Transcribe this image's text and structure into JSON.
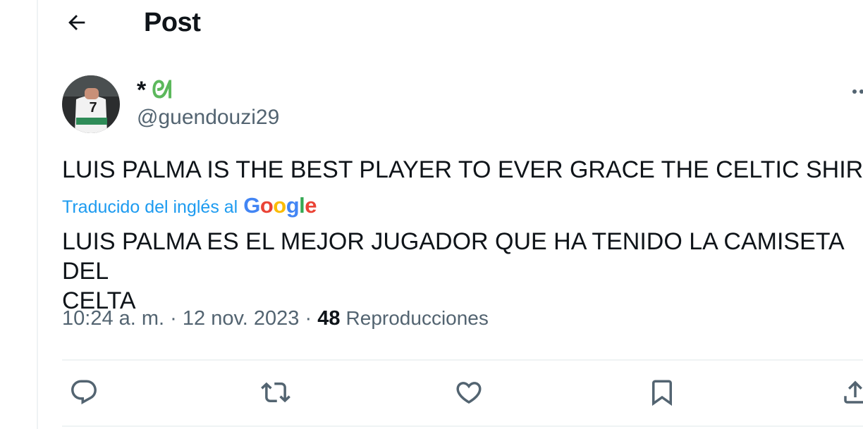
{
  "header": {
    "title": "Post",
    "back_icon": "arrow-left-icon"
  },
  "author": {
    "display_name_symbol": "*",
    "display_name_emoji": "ᘛ",
    "handle": "@guendouzi29",
    "avatar_jersey_number": "7",
    "emoji_color": "#5cb85c"
  },
  "tweet": {
    "text": "LUIS PALMA IS THE BEST PLAYER TO EVER GRACE THE CELTIC SHIRT",
    "translation_label": "Traducido del inglés al",
    "translation_provider": [
      "G",
      "o",
      "o",
      "g",
      "l",
      "e"
    ],
    "translated_text": "LUIS PALMA ES EL MEJOR JUGADOR QUE HA TENIDO LA CAMISETA DEL\nCELTA"
  },
  "meta": {
    "time": "10:24 a. m.",
    "separator": " · ",
    "date": "12 nov. 2023",
    "views_count": "48",
    "views_label": "Reproducciones"
  },
  "actions": [
    {
      "name": "reply",
      "icon": "reply-icon"
    },
    {
      "name": "repost",
      "icon": "repost-icon"
    },
    {
      "name": "like",
      "icon": "heart-icon"
    },
    {
      "name": "bookmark",
      "icon": "bookmark-icon"
    },
    {
      "name": "share",
      "icon": "share-icon"
    }
  ],
  "colors": {
    "text": "#0f1419",
    "secondary": "#536471",
    "link": "#1d9bf0",
    "border": "#eff3f4",
    "google_blue": "#4285f4",
    "google_red": "#ea4335",
    "google_yellow": "#fbbc05",
    "google_green": "#34a853"
  }
}
